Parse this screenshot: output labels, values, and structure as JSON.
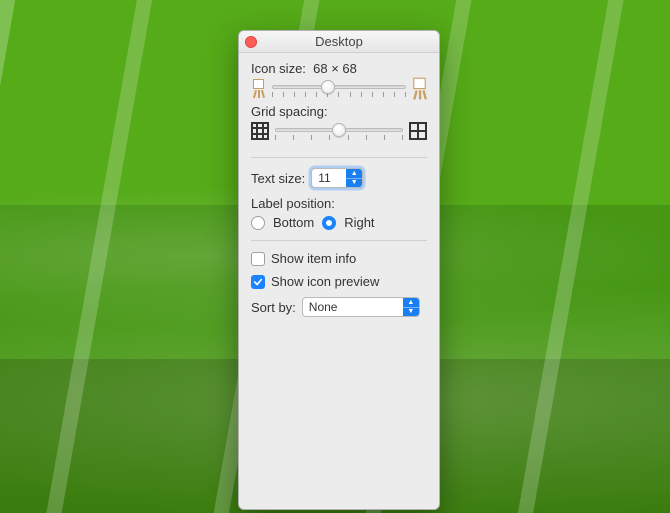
{
  "window": {
    "title": "Desktop"
  },
  "icon_size": {
    "label": "Icon size:",
    "value_text": "68 × 68",
    "slider_percent": 42
  },
  "grid_spacing": {
    "label": "Grid spacing:",
    "slider_percent": 50
  },
  "text_size": {
    "label": "Text size:",
    "value": "11"
  },
  "label_position": {
    "label": "Label position:",
    "options": {
      "bottom": "Bottom",
      "right": "Right"
    },
    "selected": "right"
  },
  "show_item_info": {
    "label": "Show item info",
    "checked": false
  },
  "show_icon_preview": {
    "label": "Show icon preview",
    "checked": true
  },
  "sort_by": {
    "label": "Sort by:",
    "value": "None"
  }
}
